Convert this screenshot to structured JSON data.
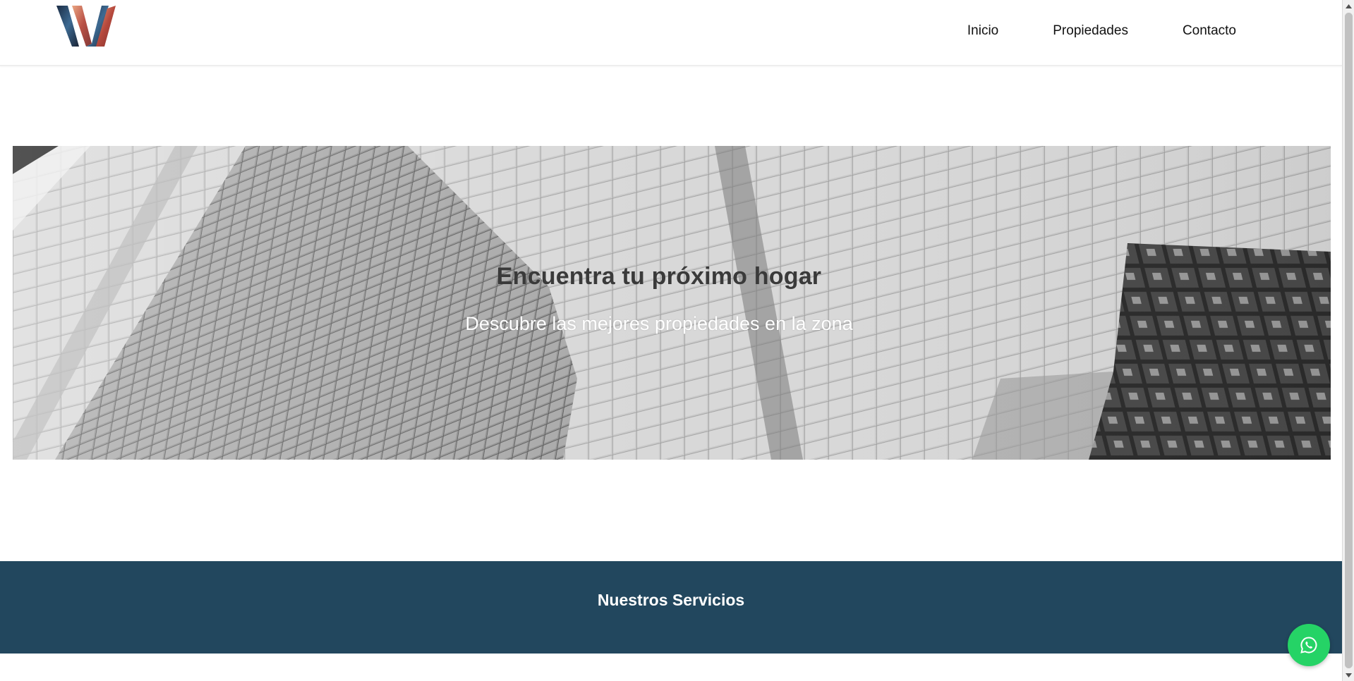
{
  "header": {
    "logo_alt": "W",
    "nav": [
      {
        "label": "Inicio"
      },
      {
        "label": "Propiedades"
      },
      {
        "label": "Contacto"
      }
    ]
  },
  "hero": {
    "title": "Encuentra tu próximo hogar",
    "subtitle": "Descubre las mejores propiedades en la zona",
    "image_icon": "building-facade-image"
  },
  "services": {
    "title": "Nuestros Servicios",
    "background_color": "#22475e"
  },
  "whatsapp": {
    "icon": "whatsapp-icon",
    "color": "#25d366"
  },
  "colors": {
    "nav_text": "#111111",
    "hero_title": "#3a3a3a",
    "hero_subtitle": "#ffffff"
  }
}
